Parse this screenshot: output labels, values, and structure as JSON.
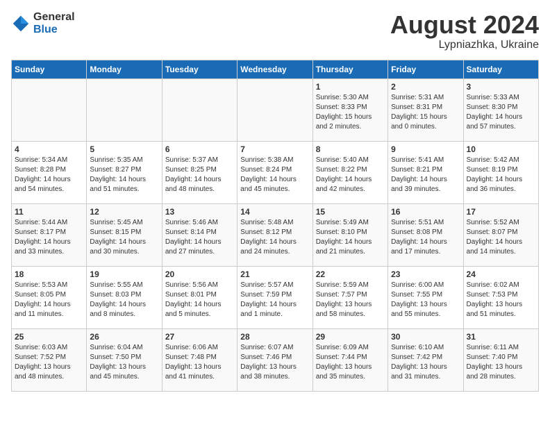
{
  "header": {
    "logo_general": "General",
    "logo_blue": "Blue",
    "month_title": "August 2024",
    "location": "Lypniazhka, Ukraine"
  },
  "days_of_week": [
    "Sunday",
    "Monday",
    "Tuesday",
    "Wednesday",
    "Thursday",
    "Friday",
    "Saturday"
  ],
  "weeks": [
    [
      {
        "day": "",
        "info": ""
      },
      {
        "day": "",
        "info": ""
      },
      {
        "day": "",
        "info": ""
      },
      {
        "day": "",
        "info": ""
      },
      {
        "day": "1",
        "info": "Sunrise: 5:30 AM\nSunset: 8:33 PM\nDaylight: 15 hours\nand 2 minutes."
      },
      {
        "day": "2",
        "info": "Sunrise: 5:31 AM\nSunset: 8:31 PM\nDaylight: 15 hours\nand 0 minutes."
      },
      {
        "day": "3",
        "info": "Sunrise: 5:33 AM\nSunset: 8:30 PM\nDaylight: 14 hours\nand 57 minutes."
      }
    ],
    [
      {
        "day": "4",
        "info": "Sunrise: 5:34 AM\nSunset: 8:28 PM\nDaylight: 14 hours\nand 54 minutes."
      },
      {
        "day": "5",
        "info": "Sunrise: 5:35 AM\nSunset: 8:27 PM\nDaylight: 14 hours\nand 51 minutes."
      },
      {
        "day": "6",
        "info": "Sunrise: 5:37 AM\nSunset: 8:25 PM\nDaylight: 14 hours\nand 48 minutes."
      },
      {
        "day": "7",
        "info": "Sunrise: 5:38 AM\nSunset: 8:24 PM\nDaylight: 14 hours\nand 45 minutes."
      },
      {
        "day": "8",
        "info": "Sunrise: 5:40 AM\nSunset: 8:22 PM\nDaylight: 14 hours\nand 42 minutes."
      },
      {
        "day": "9",
        "info": "Sunrise: 5:41 AM\nSunset: 8:21 PM\nDaylight: 14 hours\nand 39 minutes."
      },
      {
        "day": "10",
        "info": "Sunrise: 5:42 AM\nSunset: 8:19 PM\nDaylight: 14 hours\nand 36 minutes."
      }
    ],
    [
      {
        "day": "11",
        "info": "Sunrise: 5:44 AM\nSunset: 8:17 PM\nDaylight: 14 hours\nand 33 minutes."
      },
      {
        "day": "12",
        "info": "Sunrise: 5:45 AM\nSunset: 8:15 PM\nDaylight: 14 hours\nand 30 minutes."
      },
      {
        "day": "13",
        "info": "Sunrise: 5:46 AM\nSunset: 8:14 PM\nDaylight: 14 hours\nand 27 minutes."
      },
      {
        "day": "14",
        "info": "Sunrise: 5:48 AM\nSunset: 8:12 PM\nDaylight: 14 hours\nand 24 minutes."
      },
      {
        "day": "15",
        "info": "Sunrise: 5:49 AM\nSunset: 8:10 PM\nDaylight: 14 hours\nand 21 minutes."
      },
      {
        "day": "16",
        "info": "Sunrise: 5:51 AM\nSunset: 8:08 PM\nDaylight: 14 hours\nand 17 minutes."
      },
      {
        "day": "17",
        "info": "Sunrise: 5:52 AM\nSunset: 8:07 PM\nDaylight: 14 hours\nand 14 minutes."
      }
    ],
    [
      {
        "day": "18",
        "info": "Sunrise: 5:53 AM\nSunset: 8:05 PM\nDaylight: 14 hours\nand 11 minutes."
      },
      {
        "day": "19",
        "info": "Sunrise: 5:55 AM\nSunset: 8:03 PM\nDaylight: 14 hours\nand 8 minutes."
      },
      {
        "day": "20",
        "info": "Sunrise: 5:56 AM\nSunset: 8:01 PM\nDaylight: 14 hours\nand 5 minutes."
      },
      {
        "day": "21",
        "info": "Sunrise: 5:57 AM\nSunset: 7:59 PM\nDaylight: 14 hours\nand 1 minute."
      },
      {
        "day": "22",
        "info": "Sunrise: 5:59 AM\nSunset: 7:57 PM\nDaylight: 13 hours\nand 58 minutes."
      },
      {
        "day": "23",
        "info": "Sunrise: 6:00 AM\nSunset: 7:55 PM\nDaylight: 13 hours\nand 55 minutes."
      },
      {
        "day": "24",
        "info": "Sunrise: 6:02 AM\nSunset: 7:53 PM\nDaylight: 13 hours\nand 51 minutes."
      }
    ],
    [
      {
        "day": "25",
        "info": "Sunrise: 6:03 AM\nSunset: 7:52 PM\nDaylight: 13 hours\nand 48 minutes."
      },
      {
        "day": "26",
        "info": "Sunrise: 6:04 AM\nSunset: 7:50 PM\nDaylight: 13 hours\nand 45 minutes."
      },
      {
        "day": "27",
        "info": "Sunrise: 6:06 AM\nSunset: 7:48 PM\nDaylight: 13 hours\nand 41 minutes."
      },
      {
        "day": "28",
        "info": "Sunrise: 6:07 AM\nSunset: 7:46 PM\nDaylight: 13 hours\nand 38 minutes."
      },
      {
        "day": "29",
        "info": "Sunrise: 6:09 AM\nSunset: 7:44 PM\nDaylight: 13 hours\nand 35 minutes."
      },
      {
        "day": "30",
        "info": "Sunrise: 6:10 AM\nSunset: 7:42 PM\nDaylight: 13 hours\nand 31 minutes."
      },
      {
        "day": "31",
        "info": "Sunrise: 6:11 AM\nSunset: 7:40 PM\nDaylight: 13 hours\nand 28 minutes."
      }
    ]
  ]
}
